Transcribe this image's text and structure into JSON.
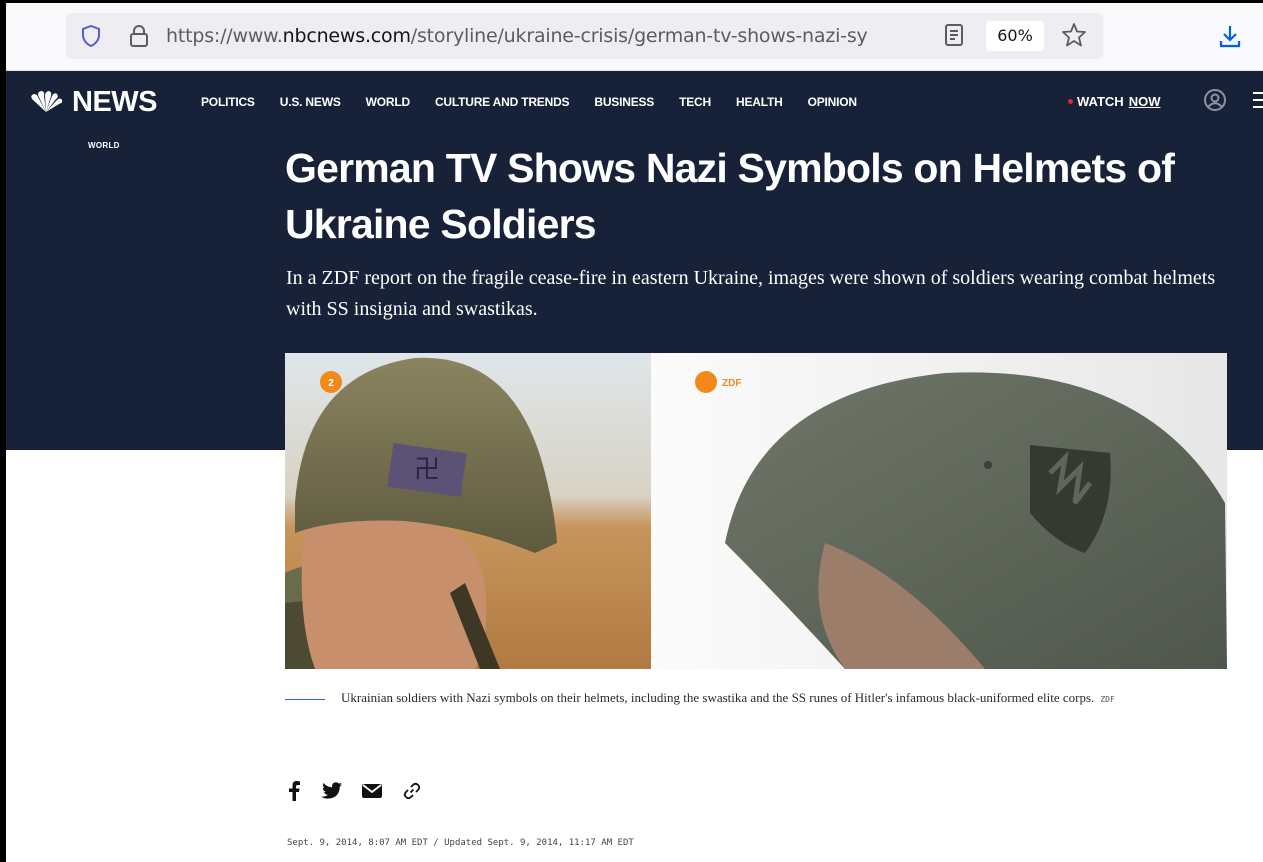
{
  "browser": {
    "url_prefix": "https://www.",
    "url_domain": "nbcnews.com",
    "url_path": "/storyline/ukraine-crisis/german-tv-shows-nazi-sy",
    "zoom": "60%",
    "icons": [
      "shield-icon",
      "lock-icon",
      "reader-view-icon",
      "star-icon",
      "download-icon"
    ]
  },
  "site": {
    "logo_text": "NEWS",
    "nav": [
      "POLITICS",
      "U.S. NEWS",
      "WORLD",
      "CULTURE AND TRENDS",
      "BUSINESS",
      "TECH",
      "HEALTH",
      "OPINION"
    ],
    "watch_label": "WATCH",
    "watch_now": "NOW"
  },
  "article": {
    "section": "WORLD",
    "headline": "German TV Shows Nazi Symbols on Helmets of Ukraine Soldiers",
    "dek": "In a ZDF report on the fragile cease-fire in eastern Ukraine, images were shown of soldiers wearing combat helmets with SS insignia and swastikas.",
    "image_watermark": "ZDF",
    "caption": "Ukrainian soldiers with Nazi symbols on their helmets, including the swastika and the SS runes of Hitler's infamous black-uniformed elite corps.",
    "caption_credit": "ZDF",
    "share_icons": [
      "facebook-icon",
      "twitter-icon",
      "email-icon",
      "link-icon"
    ],
    "dateline": "Sept. 9, 2014, 8:07 AM EDT / Updated Sept. 9, 2014, 11:17 AM EDT"
  },
  "colors": {
    "header_bg": "#172138",
    "accent_blue": "#3061ff",
    "live_red": "#e0263b"
  }
}
